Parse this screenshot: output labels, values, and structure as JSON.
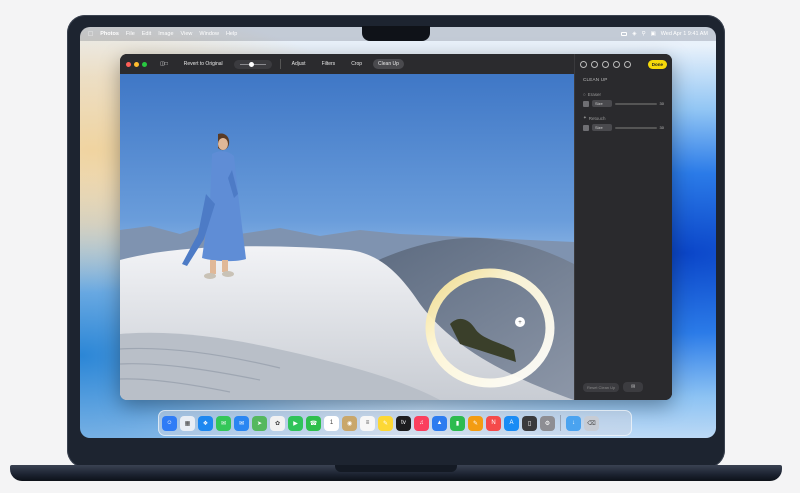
{
  "menubar": {
    "app_name": "Photos",
    "items": [
      "File",
      "Edit",
      "Image",
      "View",
      "Window",
      "Help"
    ],
    "datetime": "Wed Apr 1 9:41 AM"
  },
  "toolbar": {
    "revert_label": "Revert to Original",
    "tabs": [
      "Adjust",
      "Filters",
      "Crop",
      "Clean Up"
    ],
    "active_tab": "Clean Up"
  },
  "panel": {
    "done_label": "Done",
    "title": "CLEAN UP",
    "tools": [
      {
        "name": "Eraser",
        "size_label": "Size",
        "value": "30"
      },
      {
        "name": "Retouch",
        "size_label": "Size",
        "value": "30"
      }
    ],
    "reset_label": "Reset Clean Up"
  },
  "dock": {
    "apps": [
      {
        "icon": "finder-icon",
        "color": "#2f7cf6"
      },
      {
        "icon": "launchpad-icon",
        "color": "#e9eef5"
      },
      {
        "icon": "safari-icon",
        "color": "#1e88f0"
      },
      {
        "icon": "messages-icon",
        "color": "#34c759"
      },
      {
        "icon": "mail-icon",
        "color": "#2a86f2"
      },
      {
        "icon": "maps-icon",
        "color": "#55b85e"
      },
      {
        "icon": "photos-icon",
        "color": "#f2f2f2"
      },
      {
        "icon": "facetime-icon",
        "color": "#30c35a"
      },
      {
        "icon": "phone-icon",
        "color": "#2fbf4c"
      },
      {
        "icon": "calendar-icon",
        "color": "#ffffff"
      },
      {
        "icon": "contacts-icon",
        "color": "#c9a76b"
      },
      {
        "icon": "reminders-icon",
        "color": "#f7f7f7"
      },
      {
        "icon": "notes-icon",
        "color": "#fdd835"
      },
      {
        "icon": "tv-icon",
        "color": "#1c1c1e"
      },
      {
        "icon": "music-icon",
        "color": "#fa3f5e"
      },
      {
        "icon": "keynote-icon",
        "color": "#2d7cf0"
      },
      {
        "icon": "numbers-icon",
        "color": "#2dbb4f"
      },
      {
        "icon": "pages-icon",
        "color": "#f39c12"
      },
      {
        "icon": "news-icon",
        "color": "#f54a4a"
      },
      {
        "icon": "app-store-icon",
        "color": "#1a8cf5"
      },
      {
        "icon": "iphone-mirroring-icon",
        "color": "#3a3a3c"
      },
      {
        "icon": "system-settings-icon",
        "color": "#8e8e93"
      }
    ],
    "extras": [
      {
        "icon": "downloads-folder-icon",
        "color": "#4aa3f0"
      },
      {
        "icon": "trash-icon",
        "color": "#c7ccd4"
      }
    ]
  }
}
